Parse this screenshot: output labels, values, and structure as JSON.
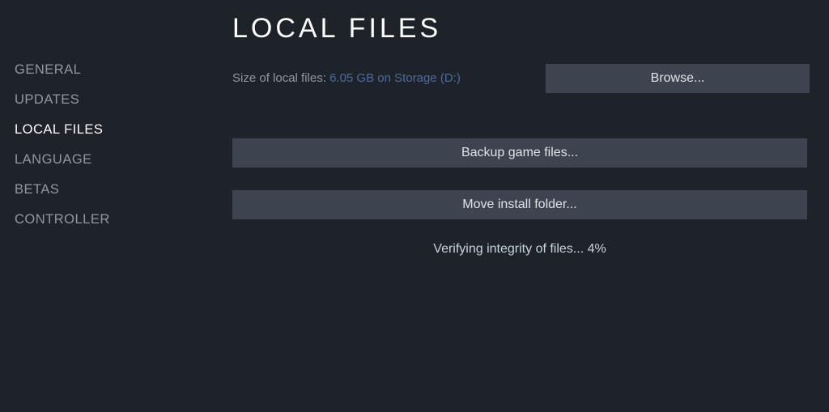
{
  "sidebar": {
    "items": [
      {
        "label": "GENERAL"
      },
      {
        "label": "UPDATES"
      },
      {
        "label": "LOCAL FILES"
      },
      {
        "label": "LANGUAGE"
      },
      {
        "label": "BETAS"
      },
      {
        "label": "CONTROLLER"
      }
    ]
  },
  "main": {
    "title": "LOCAL FILES",
    "size_label": "Size of local files: ",
    "size_value": "6.05 GB on Storage (D:)",
    "browse_label": "Browse...",
    "backup_label": "Backup game files...",
    "move_label": "Move install folder...",
    "status_text": "Verifying integrity of files... 4%"
  }
}
